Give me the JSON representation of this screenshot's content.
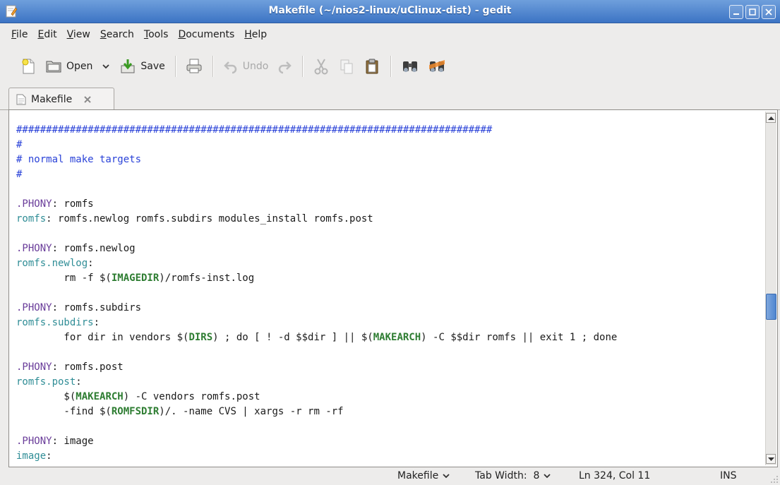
{
  "window": {
    "title": "Makefile (~/nios2-linux/uClinux-dist) - gedit"
  },
  "menu": [
    "File",
    "Edit",
    "View",
    "Search",
    "Tools",
    "Documents",
    "Help"
  ],
  "toolbar": {
    "open_label": "Open",
    "save_label": "Save",
    "undo_label": "Undo"
  },
  "tab": {
    "label": "Makefile"
  },
  "editor": {
    "lines": [
      [
        {
          "t": "################################################################################",
          "c": "cm"
        }
      ],
      [
        {
          "t": "#",
          "c": "cm"
        }
      ],
      [
        {
          "t": "# normal make targets",
          "c": "cm"
        }
      ],
      [
        {
          "t": "#",
          "c": "cm"
        }
      ],
      [],
      [
        {
          "t": ".PHONY",
          "c": "ph"
        },
        {
          "t": ": romfs",
          "c": ""
        }
      ],
      [
        {
          "t": "romfs",
          "c": "tg"
        },
        {
          "t": ": romfs.newlog romfs.subdirs modules_install romfs.post",
          "c": ""
        }
      ],
      [],
      [
        {
          "t": ".PHONY",
          "c": "ph"
        },
        {
          "t": ": romfs.newlog",
          "c": ""
        }
      ],
      [
        {
          "t": "romfs.newlog",
          "c": "tg"
        },
        {
          "t": ":",
          "c": ""
        }
      ],
      [
        {
          "t": "        rm -f $(",
          "c": ""
        },
        {
          "t": "IMAGEDIR",
          "c": "vr"
        },
        {
          "t": ")/romfs-inst.log",
          "c": ""
        }
      ],
      [],
      [
        {
          "t": ".PHONY",
          "c": "ph"
        },
        {
          "t": ": romfs.subdirs",
          "c": ""
        }
      ],
      [
        {
          "t": "romfs.subdirs",
          "c": "tg"
        },
        {
          "t": ":",
          "c": ""
        }
      ],
      [
        {
          "t": "        for dir in vendors $(",
          "c": ""
        },
        {
          "t": "DIRS",
          "c": "vr"
        },
        {
          "t": ") ; do [ ! -d $$dir ] || $(",
          "c": ""
        },
        {
          "t": "MAKEARCH",
          "c": "vr"
        },
        {
          "t": ") -C $$dir romfs || exit 1 ; done",
          "c": ""
        }
      ],
      [],
      [
        {
          "t": ".PHONY",
          "c": "ph"
        },
        {
          "t": ": romfs.post",
          "c": ""
        }
      ],
      [
        {
          "t": "romfs.post",
          "c": "tg"
        },
        {
          "t": ":",
          "c": ""
        }
      ],
      [
        {
          "t": "        $(",
          "c": ""
        },
        {
          "t": "MAKEARCH",
          "c": "vr"
        },
        {
          "t": ") -C vendors romfs.post",
          "c": ""
        }
      ],
      [
        {
          "t": "        -find $(",
          "c": ""
        },
        {
          "t": "ROMFSDIR",
          "c": "vr"
        },
        {
          "t": ")/. -name CVS | xargs -r rm -rf",
          "c": ""
        }
      ],
      [],
      [
        {
          "t": ".PHONY",
          "c": "ph"
        },
        {
          "t": ": image",
          "c": ""
        }
      ],
      [
        {
          "t": "image",
          "c": "tg"
        },
        {
          "t": ":",
          "c": ""
        }
      ]
    ]
  },
  "status": {
    "language": "Makefile",
    "tab_width": "Tab Width:  8",
    "position": "Ln 324, Col 11",
    "mode": "INS"
  },
  "scrollbar": {
    "position_fraction": 0.56
  }
}
